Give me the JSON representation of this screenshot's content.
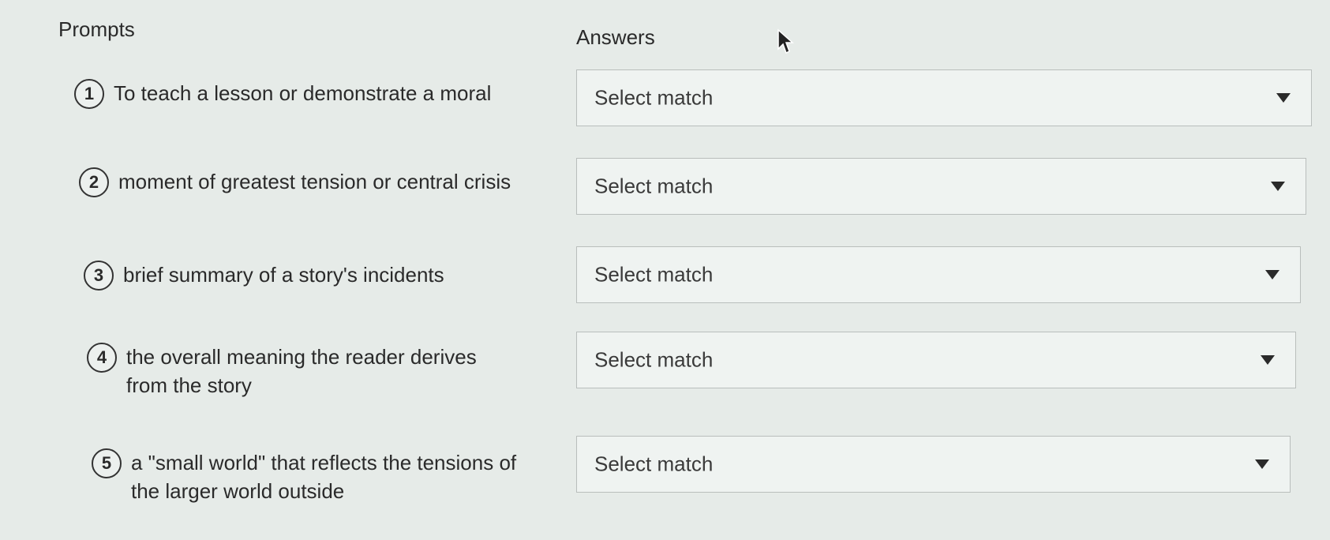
{
  "headers": {
    "prompts": "Prompts",
    "answers": "Answers"
  },
  "prompts": [
    {
      "number": "1",
      "text": "To teach a lesson or demonstrate a moral",
      "answer": "Select match"
    },
    {
      "number": "2",
      "text": "moment of greatest tension or central crisis",
      "answer": "Select match"
    },
    {
      "number": "3",
      "text": "brief summary of a story's incidents",
      "answer": "Select match"
    },
    {
      "number": "4",
      "text": "the overall meaning the reader derives from the story",
      "answer": "Select match"
    },
    {
      "number": "5",
      "text": "a \"small world\" that reflects the tensions of the larger world outside",
      "answer": "Select match"
    }
  ],
  "icons": {
    "dropdown": "chevron-down-icon",
    "cursor": "mouse-pointer-icon"
  }
}
